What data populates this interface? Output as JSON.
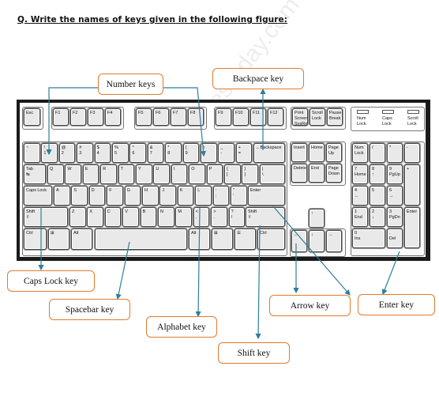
{
  "question": "Q. Write the names of keys given in the following figure:",
  "watermark": "https://www.studiestoday.com",
  "callouts": {
    "number_keys": "Number keys",
    "backspace_key": "Backpace key",
    "caps_lock_key": "Caps Lock key",
    "spacebar_key": "Spacebar key",
    "alphabet_key": "Alphabet key",
    "shift_key": "Shift key",
    "arrow_key": "Arrow key",
    "enter_key": "Enter key"
  },
  "colors": {
    "callout_border": "#e07b2e",
    "arrow": "#2e7f97",
    "keyboard_frame": "#1a1a1a"
  },
  "keyboard": {
    "function_row": [
      "Esc",
      "F1",
      "F2",
      "F3",
      "F4",
      "F5",
      "F6",
      "F7",
      "F8",
      "F9",
      "F10",
      "F11",
      "F12"
    ],
    "system_keys": [
      "Print\nScreen\nSysRq",
      "Scroll\nLock",
      "Pause\nBreak"
    ],
    "indicators": [
      "Num\nLock",
      "Caps\nLock",
      "Scroll\nLock"
    ],
    "number_row": [
      "~\n`",
      "!\n1",
      "@\n2",
      "#\n3",
      "$\n4",
      "%\n5",
      "^\n6",
      "&\n7",
      "*\n8",
      "(\n9",
      ")\n0",
      "_\n-",
      "+\n=",
      "←Backspace"
    ],
    "qwerty_row": [
      "Tab\n↹",
      "Q",
      "W",
      "E",
      "R",
      "T",
      "Y",
      "U",
      "I",
      "O",
      "P",
      "{\n[",
      "}\n]",
      "|\n\\"
    ],
    "home_row": [
      "Caps Lock",
      "A",
      "S",
      "D",
      "F",
      "G",
      "H",
      "J",
      "K",
      "L",
      ":\n;",
      "\"\n'",
      "Enter"
    ],
    "shift_row": [
      "Shift\n⇧",
      "Z",
      "X",
      "C",
      "V",
      "B",
      "N",
      "M",
      "<\n,",
      ">\n.",
      "?\n/",
      "Shift\n⇧"
    ],
    "bottom_row": [
      "Ctrl",
      "⊞",
      "Alt",
      "",
      "Alt",
      "⊞",
      "☰",
      "Ctrl"
    ],
    "nav_keys": [
      "Insert",
      "Home",
      "Page\nUp",
      "Delete",
      "End",
      "Page\nDown"
    ],
    "arrow_keys": [
      "↑",
      "←",
      "↓",
      "→"
    ],
    "numpad": [
      "Num\nLock",
      "/",
      "*",
      "-",
      "7\nHome",
      "8\n↑",
      "9\nPgUp",
      "+",
      "4\n←",
      "5",
      "6\n→",
      "1\nEnd",
      "2\n↓",
      "3\nPgDn",
      "Enter",
      "0\nIns",
      ".\nDel"
    ]
  }
}
